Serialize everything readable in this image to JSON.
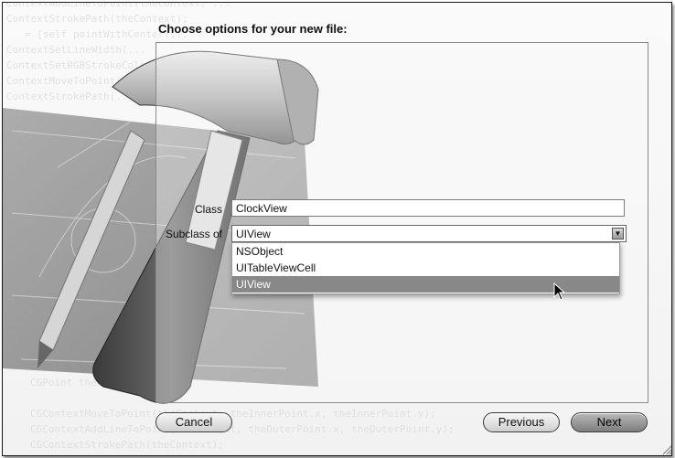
{
  "dialog": {
    "title": "Choose options for your new file:"
  },
  "form": {
    "class_label": "Class",
    "class_value": "ClockView",
    "subclass_label": "Subclass of",
    "subclass_value": "UIView"
  },
  "dropdown": {
    "options": [
      "NSObject",
      "UITableViewCell",
      "UIView"
    ],
    "selected": "UIView"
  },
  "buttons": {
    "cancel": "Cancel",
    "previous": "Previous",
    "next": "Next"
  }
}
